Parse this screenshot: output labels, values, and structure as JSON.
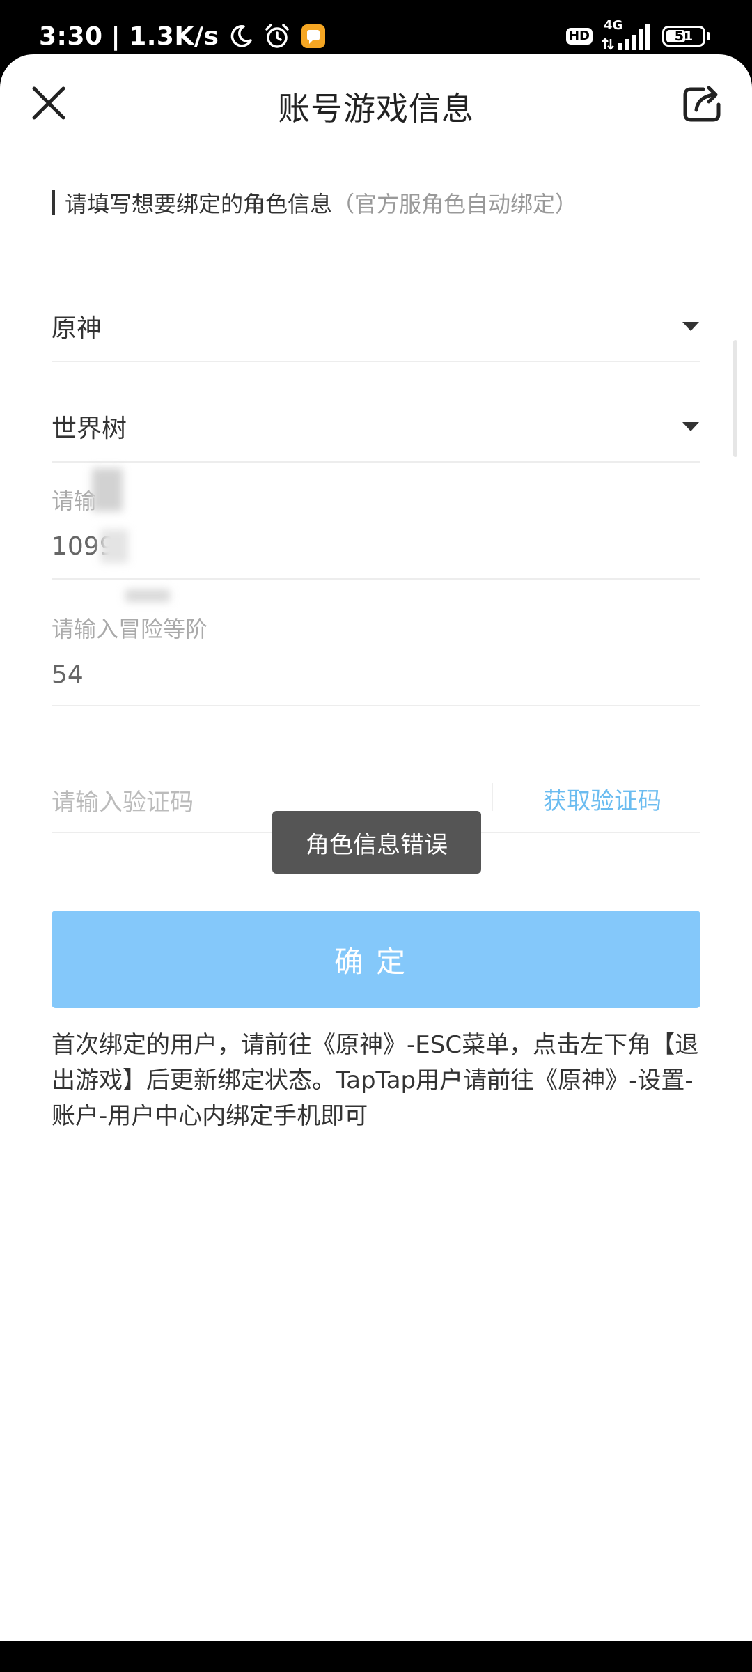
{
  "status_bar": {
    "time": "3:30",
    "separator": "|",
    "net_speed": "1.3K/s",
    "hd_label": "HD",
    "network_label": "4G",
    "battery": "51",
    "battery_level_percent": 51,
    "icons": [
      "moon-icon",
      "alarm-icon",
      "notification-app-icon",
      "signal-icon",
      "battery-icon"
    ]
  },
  "header": {
    "title": "账号游戏信息",
    "close_icon": "close-icon",
    "share_icon": "share-icon"
  },
  "form": {
    "section_heading": "请填写想要绑定的角色信息",
    "section_note": "（官方服角色自动绑定）",
    "game_select": {
      "value": "原神"
    },
    "server_select": {
      "value": "世界树"
    },
    "uid_field": {
      "label": "请输",
      "value": "1099"
    },
    "rank_field": {
      "label": "请输入冒险等阶",
      "value": "54"
    },
    "code_field": {
      "placeholder": "请输入验证码",
      "get_code_label": "获取验证码"
    }
  },
  "toast": {
    "message": "角色信息错误"
  },
  "confirm_button": {
    "label": "确定"
  },
  "notice": "首次绑定的用户，请前往《原神》-ESC菜单，点击左下角【退出游戏】后更新绑定状态。TapTap用户请前往《原神》-设置-账户-用户中心内绑定手机即可",
  "colors": {
    "accent_link": "#6bbcf0",
    "confirm_button": "#84c8fa",
    "toast_bg": "#555555"
  }
}
